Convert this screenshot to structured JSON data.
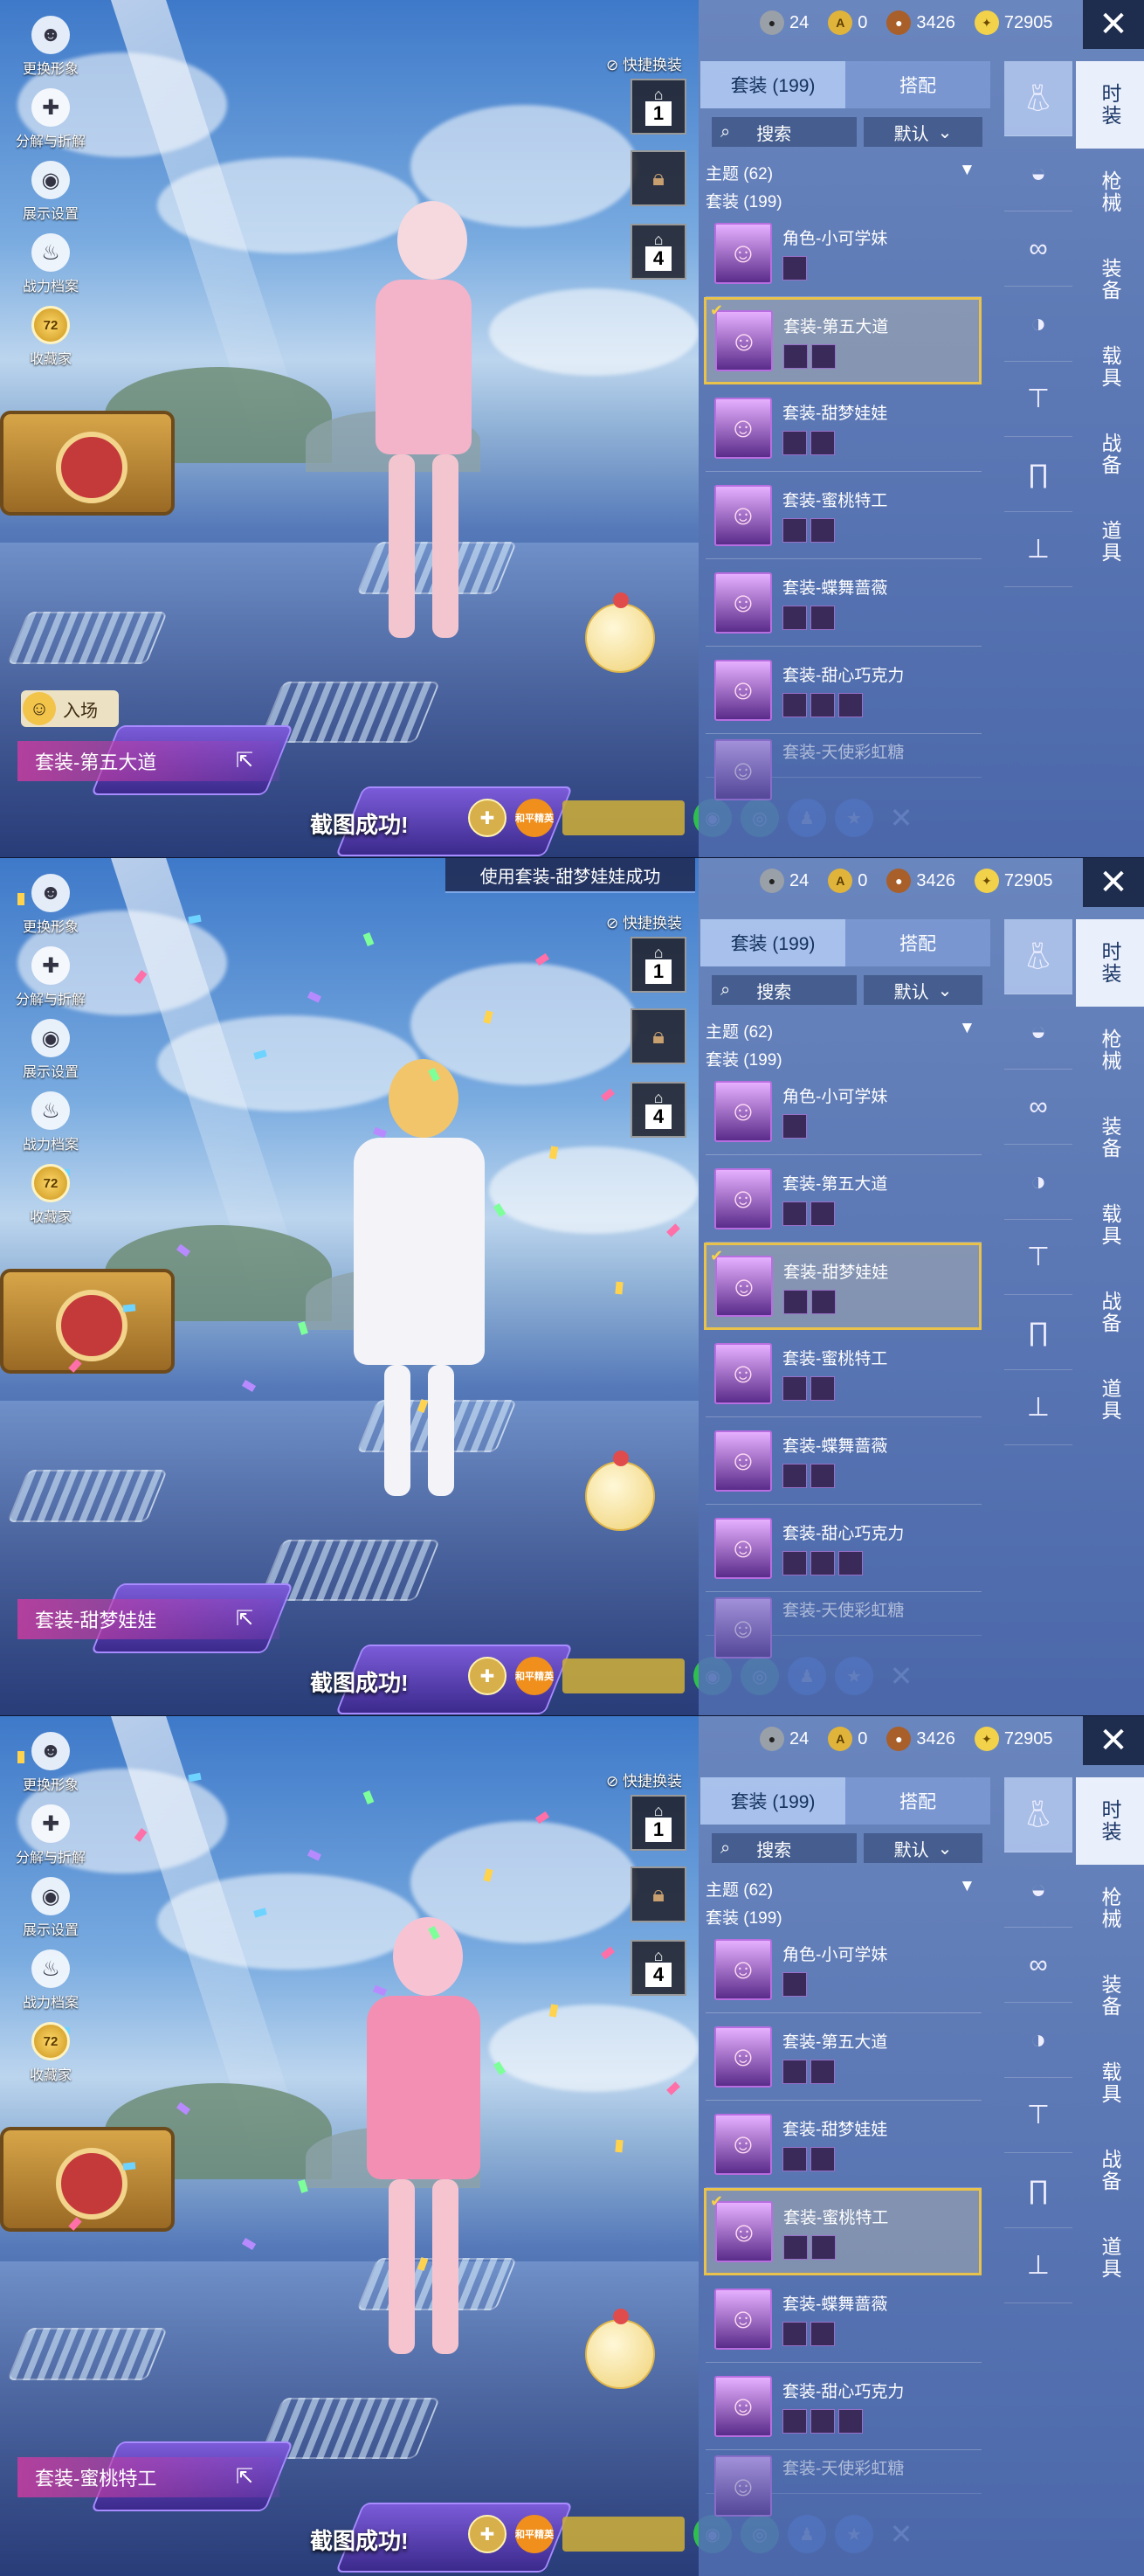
{
  "currency": {
    "silver": "24",
    "ag": "0",
    "bp": "3426",
    "uc": "72905"
  },
  "close_icon": "✕",
  "left_menu": [
    {
      "label": "更换形象",
      "icon": "person-icon"
    },
    {
      "label": "分解与折解",
      "icon": "puzzle-icon"
    },
    {
      "label": "展示设置",
      "icon": "eye-icon"
    },
    {
      "label": "战力档案",
      "icon": "flame-icon"
    },
    {
      "label": "收藏家",
      "icon": "badge-icon",
      "badge": "72"
    }
  ],
  "quick_change": "快捷换装",
  "quick_slots": [
    "1",
    "",
    "4"
  ],
  "tabs": {
    "outfit": "套装 (199)",
    "match": "搭配"
  },
  "search": {
    "label": "搜索",
    "sort": "默认"
  },
  "sections": {
    "theme": "主题 (62)",
    "outfit": "套装 (199)"
  },
  "list_items": [
    "角色-小可学妹",
    "套装-第五大道",
    "套装-甜梦娃娃",
    "套装-蜜桃特工",
    "套装-蝶舞蔷薇",
    "套装-甜心巧克力",
    "套装-天使彩虹糖"
  ],
  "categories": [
    "时装",
    "枪械",
    "装备",
    "载具",
    "战备",
    "道具"
  ],
  "entry": "入场",
  "screenshot_toast": "截图成功!",
  "bottom_icon_labels": {
    "orange": "和平精英"
  },
  "panels": [
    {
      "outfit_label": "套装-第五大道",
      "selected": 1,
      "toast": ""
    },
    {
      "outfit_label": "套装-甜梦娃娃",
      "selected": 2,
      "toast": "使用套装-甜梦娃娃成功"
    },
    {
      "outfit_label": "套装-蜜桃特工",
      "selected": 3,
      "toast": ""
    }
  ]
}
